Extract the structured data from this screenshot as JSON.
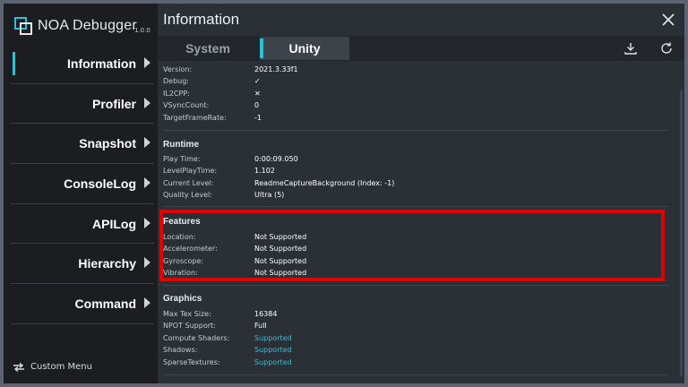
{
  "app": {
    "name": "NOA Debugger",
    "version": "1.0.0"
  },
  "sidebar": {
    "items": [
      {
        "label": "Information"
      },
      {
        "label": "Profiler"
      },
      {
        "label": "Snapshot"
      },
      {
        "label": "ConsoleLog"
      },
      {
        "label": "APILog"
      },
      {
        "label": "Hierarchy"
      },
      {
        "label": "Command"
      }
    ],
    "custom_menu": "Custom Menu"
  },
  "header": {
    "title": "Information"
  },
  "tabs": [
    {
      "label": "System"
    },
    {
      "label": "Unity"
    }
  ],
  "colors": {
    "accent": "#2cc1d8",
    "supported": "#32c0d4",
    "highlight": "#e00000"
  },
  "info": {
    "version": {
      "key": "Version:",
      "value": "2021.3.33f1"
    },
    "debug": {
      "key": "Debug:",
      "value": "✓"
    },
    "il2cpp": {
      "key": "IL2CPP:",
      "value": "✕"
    },
    "vsync": {
      "key": "VSyncCount:",
      "value": "0"
    },
    "target_fps": {
      "key": "TargetFrameRate:",
      "value": "-1"
    }
  },
  "runtime": {
    "title": "Runtime",
    "rows": [
      {
        "key": "Play Time:",
        "value": "0:00:09.050"
      },
      {
        "key": "LevelPlayTime:",
        "value": "1.102"
      },
      {
        "key": "Current Level:",
        "value": "ReadmeCaptureBackground (Index: -1)"
      },
      {
        "key": "Quality Level:",
        "value": "Ultra (5)"
      }
    ]
  },
  "features": {
    "title": "Features",
    "rows": [
      {
        "key": "Location:",
        "value": "Not Supported"
      },
      {
        "key": "Accelerometer:",
        "value": "Not Supported"
      },
      {
        "key": "Gyroscope:",
        "value": "Not Supported"
      },
      {
        "key": "Vibration:",
        "value": "Not Supported"
      }
    ]
  },
  "graphics": {
    "title": "Graphics",
    "rows": [
      {
        "key": "Max Tex Size:",
        "value": "16384"
      },
      {
        "key": "NPOT Support:",
        "value": "Full"
      },
      {
        "key": "Compute Shaders:",
        "value": "Supported"
      },
      {
        "key": "Shadows:",
        "value": "Supported"
      },
      {
        "key": "SparseTextures:",
        "value": "Supported"
      }
    ]
  }
}
